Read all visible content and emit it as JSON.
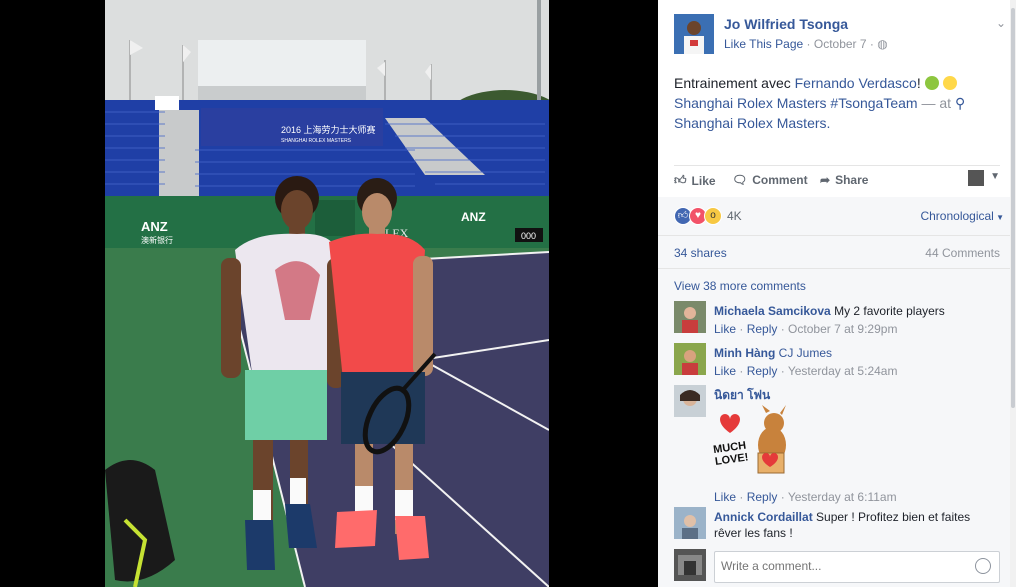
{
  "post": {
    "author": "Jo Wilfried Tsonga",
    "like_page": "Like This Page",
    "date": "October 7",
    "text_start": "Entrainement avec ",
    "mention": "Fernando Verdasco",
    "text_end": "!",
    "location": "Shanghai Rolex Masters #TsongaTeam",
    "at": "— at",
    "place": "Shanghai Rolex Masters",
    "place_end": "."
  },
  "actions": {
    "like": "Like",
    "comment": "Comment",
    "share": "Share"
  },
  "stats": {
    "reactions": "4K",
    "sort": "Chronological",
    "shares": "34 shares",
    "comments": "44 Comments",
    "more_comments": "View 38 more comments"
  },
  "comments": [
    {
      "name": "Michaela Samcikova",
      "text": "My 2 favorite players",
      "like": "Like",
      "reply": "Reply",
      "time": "October 7 at 9:29pm"
    },
    {
      "name": "Minh Hàng",
      "text": "CJ Jumes",
      "like": "Like",
      "reply": "Reply",
      "time": "Yesterday at 5:24am"
    },
    {
      "name": "นิดยา โฟน",
      "text": "",
      "like": "Like",
      "reply": "Reply",
      "time": "Yesterday at 6:11am",
      "sticker_text": "MUCH LOVE!"
    },
    {
      "name": "Annick Cordaillat",
      "text": "Super ! Profitez bien et faites rêver les fans !"
    }
  ],
  "write": {
    "placeholder": "Write a comment..."
  },
  "photo": {
    "banner": "2016 上海劳力士大师赛",
    "banner_sub": "SHANGHAI ROLEX MASTERS",
    "sponsor": "ANZ",
    "sponsor_sub": "澳新银行",
    "scoreboard": "000",
    "rolex": "LEX"
  },
  "colors": {
    "link": "#365899",
    "court": "#3f3e64",
    "surround": "#3a7c4c",
    "seats": "#1f3fa6"
  }
}
